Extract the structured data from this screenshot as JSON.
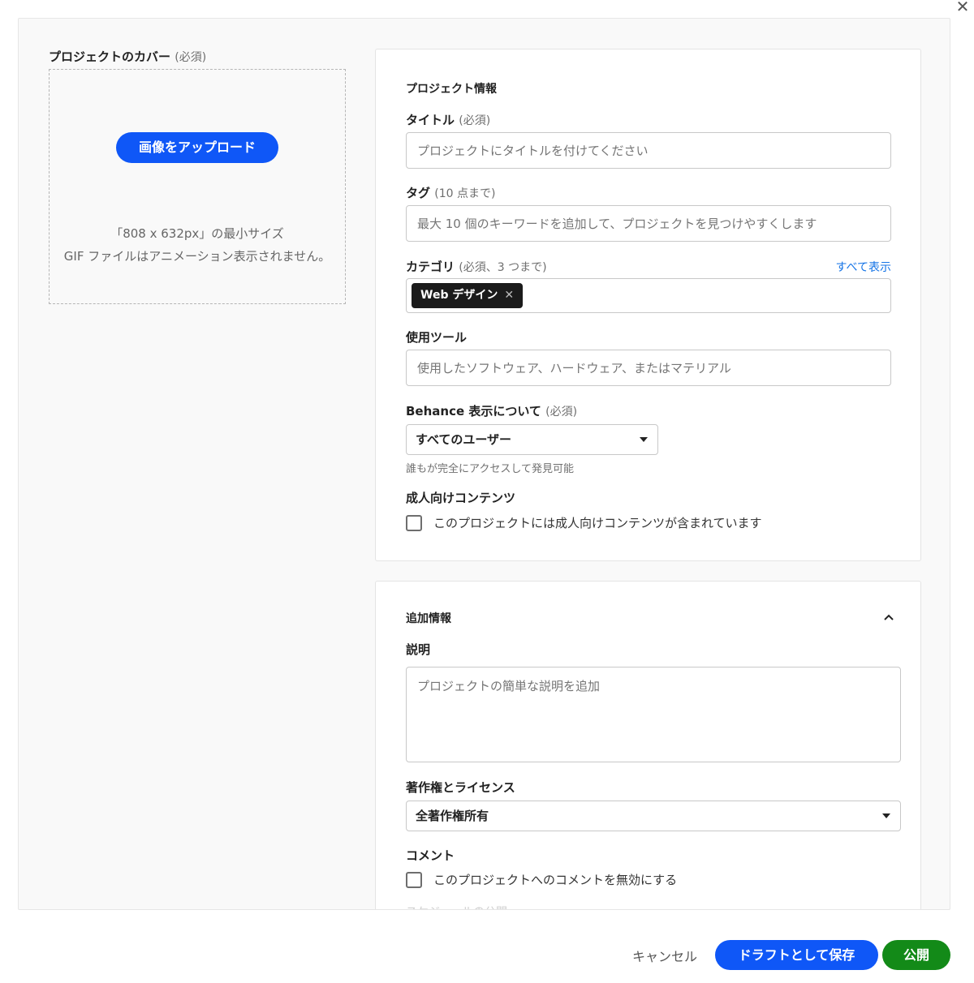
{
  "window": {
    "close_glyph": "✕"
  },
  "cover": {
    "label": "プロジェクトのカバー",
    "required": "(必須)",
    "upload_label": "画像をアップロード",
    "min_size_note": "「808 x 632px」の最小サイズ",
    "gif_note": "GIF ファイルはアニメーション表示されません。"
  },
  "info": {
    "section_title": "プロジェクト情報",
    "title_label": "タイトル",
    "title_req": "(必須)",
    "title_placeholder": "プロジェクトにタイトルを付けてください",
    "tags_label": "タグ",
    "tags_req": "(10 点まで)",
    "tags_placeholder": "最大 10 個のキーワードを追加して、プロジェクトを見つけやすくします",
    "category_label": "カテゴリ",
    "category_req": "(必須、3 つまで)",
    "see_all": "すべて表示",
    "category_chip": "Web デザイン",
    "chip_remove": "✕",
    "tools_label": "使用ツール",
    "tools_placeholder": "使用したソフトウェア、ハードウェア、またはマテリアル",
    "visibility_label": "Behance 表示について",
    "visibility_req": "(必須)",
    "visibility_value": "すべてのユーザー",
    "visibility_helper": "誰もが完全にアクセスして発見可能",
    "adult_label": "成人向けコンテンツ",
    "adult_checkbox": "このプロジェクトには成人向けコンテンツが含まれています"
  },
  "extra": {
    "section_title": "追加情報",
    "description_label": "説明",
    "description_placeholder": "プロジェクトの簡単な説明を追加",
    "license_label": "著作権とライセンス",
    "license_value": "全著作権所有",
    "comments_label": "コメント",
    "comments_checkbox": "このプロジェクトへのコメントを無効にする",
    "next_faded": "スケジュールの公開"
  },
  "footer": {
    "cancel": "キャンセル",
    "save_draft": "ドラフトとして保存",
    "publish": "公開"
  },
  "colors": {
    "primary_blue": "#0f57f7",
    "publish_green": "#138a18",
    "link_blue": "#1473e6",
    "chip_dark": "#1b1b1b"
  }
}
